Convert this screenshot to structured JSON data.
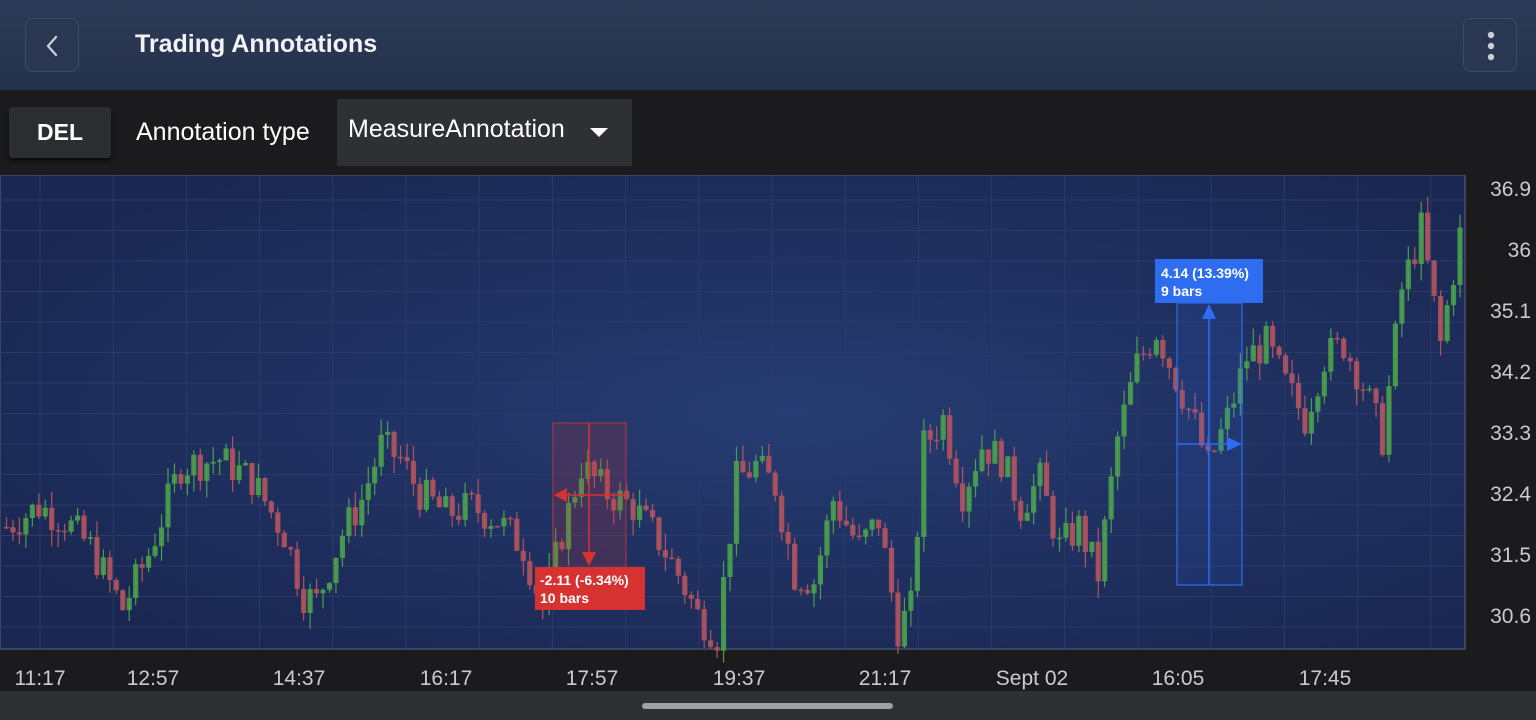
{
  "app_bar": {
    "title": "Trading Annotations",
    "back_icon": "chevron-left-icon",
    "menu_icon": "more-vertical-icon"
  },
  "toolbar": {
    "delete_label": "DEL",
    "annotation_type_label": "Annotation type",
    "annotation_type_value": "MeasureAnnotation",
    "dropdown_icon": "caret-down-icon"
  },
  "chart_data": {
    "type": "candlestick",
    "y_ticks": [
      "36.9",
      "36",
      "35.1",
      "34.2",
      "33.3",
      "32.4",
      "31.5",
      "30.6"
    ],
    "x_ticks": [
      "11:17",
      "12:57",
      "14:37",
      "16:17",
      "17:57",
      "19:37",
      "21:17",
      "Sept 02",
      "16:05",
      "17:45"
    ],
    "ylim": [
      29.9,
      37.0
    ],
    "grid": true,
    "colors": {
      "up": "#4a9e4e",
      "down": "#b0535e",
      "measure_negative": "#d63232",
      "measure_positive": "#2f6df0",
      "plot_background": "#1c2b55",
      "axis_text": "#c9cbd1"
    },
    "annotations": [
      {
        "type": "MeasureAnnotation",
        "direction": "down",
        "value_text": "-2.11 (-6.34%)",
        "bars_text": "10 bars",
        "color": "#d63232"
      },
      {
        "type": "MeasureAnnotation",
        "direction": "up",
        "value_text": "4.14 (13.39%)",
        "bars_text": "9 bars",
        "color": "#2f6df0"
      }
    ]
  }
}
